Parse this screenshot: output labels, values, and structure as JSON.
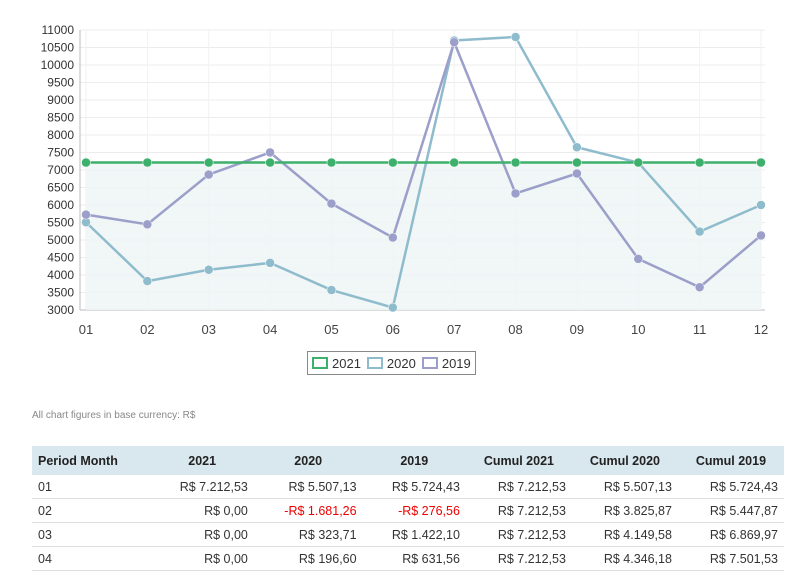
{
  "chart_data": {
    "type": "line",
    "categories": [
      "01",
      "02",
      "03",
      "04",
      "05",
      "06",
      "07",
      "08",
      "09",
      "10",
      "11",
      "12"
    ],
    "ylim": [
      3000,
      11000
    ],
    "yticks": [
      11000,
      10500,
      10000,
      9500,
      9000,
      8500,
      8000,
      7500,
      7000,
      6500,
      6000,
      5500,
      5000,
      4500,
      4000,
      3500,
      3000
    ],
    "grid": true,
    "legend_placement": "bottom",
    "series": [
      {
        "name": "2021",
        "color": "#3db06b",
        "fill": true,
        "values": [
          7212.53,
          7212.53,
          7212.53,
          7212.53,
          7212.53,
          7212.53,
          7212.53,
          7212.53,
          7212.53,
          7212.53,
          7212.53,
          7212.53
        ]
      },
      {
        "name": "2020",
        "color": "#8fbccc",
        "fill": false,
        "values": [
          5507.13,
          3825.87,
          4149.58,
          4346.18,
          3570,
          3070,
          10700,
          10800,
          7650,
          7212,
          5240,
          6000
        ]
      },
      {
        "name": "2019",
        "color": "#9b9fc9",
        "fill": false,
        "values": [
          5724.43,
          5447.87,
          6869.97,
          7501.53,
          6040,
          5070,
          10650,
          6330,
          6900,
          4460,
          3650,
          5130
        ]
      }
    ]
  },
  "legend": [
    {
      "label": "2021",
      "color": "#3db06b"
    },
    {
      "label": "2020",
      "color": "#8fbccc"
    },
    {
      "label": "2019",
      "color": "#9b9fc9"
    }
  ],
  "note": "All chart figures in base currency: R$",
  "table": {
    "headers": [
      "Period Month",
      "2021",
      "2020",
      "2019",
      "Cumul 2021",
      "Cumul 2020",
      "Cumul 2019"
    ],
    "rows": [
      {
        "cells": [
          "01",
          "R$ 7.212,53",
          "R$ 5.507,13",
          "R$ 5.724,43",
          "R$ 7.212,53",
          "R$ 5.507,13",
          "R$ 5.724,43"
        ],
        "negative": [
          false,
          false,
          false,
          false,
          false,
          false,
          false
        ]
      },
      {
        "cells": [
          "02",
          "R$ 0,00",
          "-R$ 1.681,26",
          "-R$ 276,56",
          "R$ 7.212,53",
          "R$ 3.825,87",
          "R$ 5.447,87"
        ],
        "negative": [
          false,
          false,
          true,
          true,
          false,
          false,
          false
        ]
      },
      {
        "cells": [
          "03",
          "R$ 0,00",
          "R$ 323,71",
          "R$ 1.422,10",
          "R$ 7.212,53",
          "R$ 4.149,58",
          "R$ 6.869,97"
        ],
        "negative": [
          false,
          false,
          false,
          false,
          false,
          false,
          false
        ]
      },
      {
        "cells": [
          "04",
          "R$ 0,00",
          "R$ 196,60",
          "R$ 631,56",
          "R$ 7.212,53",
          "R$ 4.346,18",
          "R$ 7.501,53"
        ],
        "negative": [
          false,
          false,
          false,
          false,
          false,
          false,
          false
        ]
      }
    ]
  }
}
